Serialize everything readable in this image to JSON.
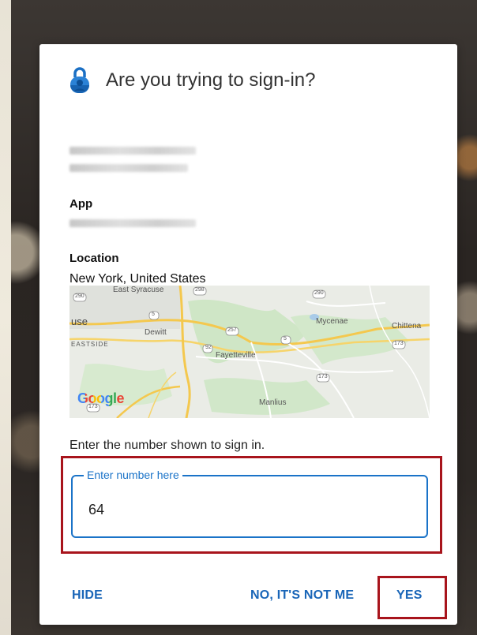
{
  "dialog": {
    "title": "Are you trying to sign-in?",
    "app_label": "App",
    "location_label": "Location",
    "location_value": "New York, United States",
    "prompt": "Enter the number shown to sign in.",
    "input": {
      "legend": "Enter number here",
      "value": "64"
    },
    "buttons": {
      "hide": "HIDE",
      "not_me": "NO, IT'S NOT ME",
      "yes": "YES"
    }
  },
  "map": {
    "labels": [
      "East Syracuse",
      "Dewitt",
      "Mycenae",
      "Chittena",
      "Fayetteville",
      "Manlius",
      "EASTSIDE",
      "use"
    ],
    "road_numbers": [
      "290",
      "298",
      "290",
      "5",
      "257",
      "5",
      "173",
      "92",
      "173",
      "173"
    ],
    "brand": "Google"
  },
  "colors": {
    "accent": "#1a73c8",
    "button_text": "#1a66b8",
    "highlight": "#a8141c"
  }
}
